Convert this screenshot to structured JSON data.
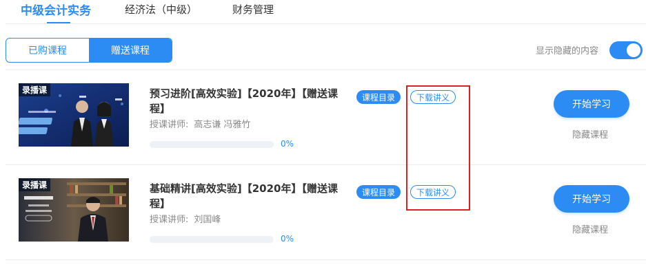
{
  "subject_tabs": [
    {
      "label": "中级会计实务",
      "active": true
    },
    {
      "label": "经济法（中级）",
      "active": false
    },
    {
      "label": "财务管理",
      "active": false
    }
  ],
  "segment": {
    "purchased_label": "已购课程",
    "gifted_label": "赠送课程",
    "selected": "赠送课程"
  },
  "hidden_toggle": {
    "label": "显示隐藏的内容",
    "on": true
  },
  "courses": [
    {
      "badge": "录播课",
      "title": "预习进阶[高效实验]【2020年】【赠送课程】",
      "teacher_label": "授课讲师:",
      "teacher_names": "高志谦 冯雅竹",
      "progress_percent": 0,
      "progress_text": "0%",
      "catalog_label": "课程目录",
      "handout_label": "下载讲义",
      "start_label": "开始学习",
      "hide_label": "隐藏课程"
    },
    {
      "badge": "录播课",
      "title": "基础精讲[高效实验]【2020年】【赠送课程】",
      "teacher_label": "授课讲师:",
      "teacher_names": "刘国峰",
      "progress_percent": 0,
      "progress_text": "0%",
      "catalog_label": "课程目录",
      "handout_label": "下载讲义",
      "start_label": "开始学习",
      "hide_label": "隐藏课程"
    }
  ],
  "colors": {
    "accent": "#2c8cf4",
    "highlight": "#e02020"
  }
}
